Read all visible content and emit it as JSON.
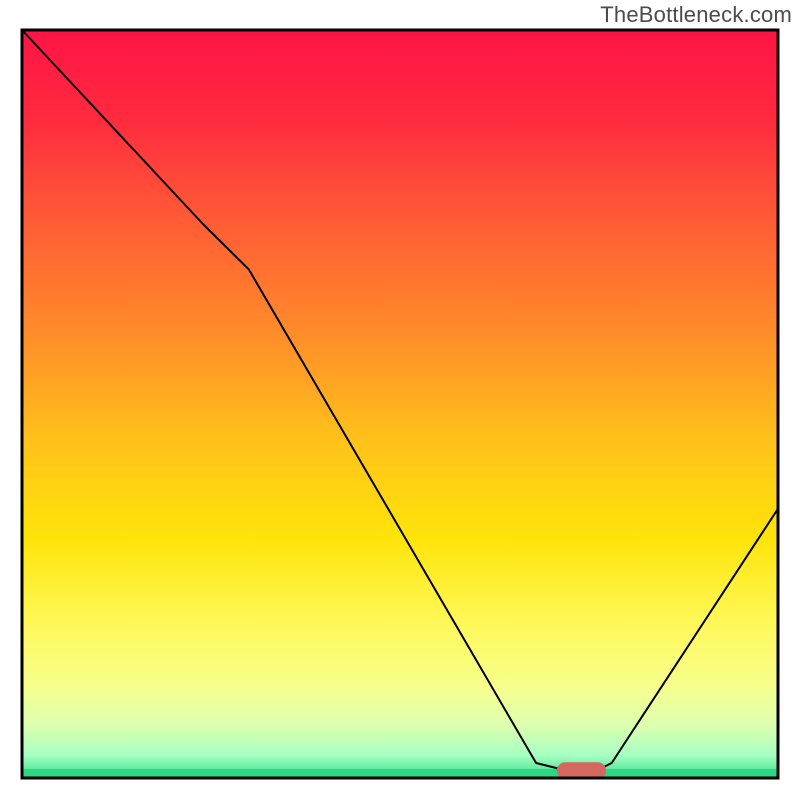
{
  "watermark": "TheBottleneck.com",
  "chart_data": {
    "type": "line",
    "title": "",
    "xlabel": "",
    "ylabel": "",
    "xlim": [
      0,
      100
    ],
    "ylim": [
      0,
      100
    ],
    "axes_visible": false,
    "background_gradient": {
      "stops": [
        {
          "offset": 0.0,
          "color": "#ff1445"
        },
        {
          "offset": 0.12,
          "color": "#ff2b3f"
        },
        {
          "offset": 0.25,
          "color": "#ff5a36"
        },
        {
          "offset": 0.4,
          "color": "#ff8a2a"
        },
        {
          "offset": 0.55,
          "color": "#ffc21a"
        },
        {
          "offset": 0.68,
          "color": "#ffe40a"
        },
        {
          "offset": 0.8,
          "color": "#fff95e"
        },
        {
          "offset": 0.88,
          "color": "#f6ff8e"
        },
        {
          "offset": 0.93,
          "color": "#dcffb0"
        },
        {
          "offset": 0.97,
          "color": "#a5ffc2"
        },
        {
          "offset": 1.0,
          "color": "#35e08a"
        }
      ]
    },
    "border_color": "#000000",
    "series": [
      {
        "name": "bottleneck-curve",
        "color": "#000000",
        "stroke_width": 2,
        "x": [
          0,
          24,
          30,
          68,
          72,
          76,
          78,
          100
        ],
        "values": [
          100,
          74,
          68,
          2,
          1,
          1,
          2,
          36
        ]
      }
    ],
    "marker": {
      "name": "optimal-band",
      "x_center": 74,
      "y": 1,
      "width": 6.5,
      "height": 2.2,
      "color": "#d4685e"
    }
  }
}
